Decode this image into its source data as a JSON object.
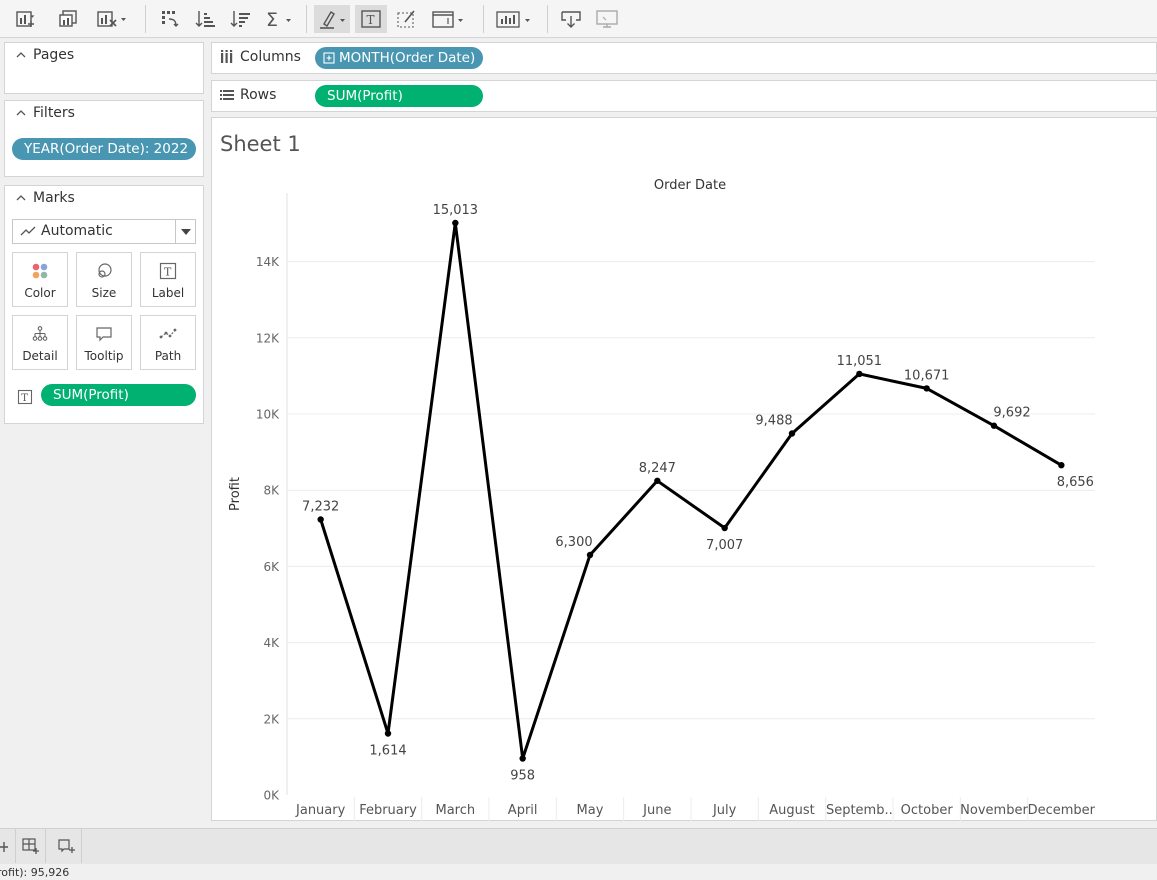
{
  "toolbar": {
    "icons": [
      "new-worksheet-icon",
      "duplicate-sheet-icon",
      "clear-sheet-icon",
      "swap-rows-columns-icon",
      "sort-ascending-icon",
      "sort-descending-icon",
      "totals-icon",
      "highlight-icon",
      "show-mark-labels-icon",
      "format-workbook-icon",
      "fit-icon",
      "show-me-icon",
      "download-icon",
      "presentation-mode-icon"
    ]
  },
  "pages": {
    "title": "Pages"
  },
  "filters": {
    "title": "Filters",
    "items": [
      "YEAR(Order Date): 2022"
    ]
  },
  "marks": {
    "title": "Marks",
    "type": "Automatic",
    "cards": [
      "Color",
      "Size",
      "Label",
      "Detail",
      "Tooltip",
      "Path"
    ],
    "fields": [
      "SUM(Profit)"
    ]
  },
  "columns": {
    "label": "Columns",
    "pill": "MONTH(Order Date)"
  },
  "rows": {
    "label": "Rows",
    "pill": "SUM(Profit)"
  },
  "sheet": {
    "title": "Sheet 1"
  },
  "colors": {
    "dimension_pill": "#4996b2",
    "measure_pill": "#00b171",
    "line": "#000000"
  },
  "chart_data": {
    "type": "line",
    "title": "Order Date",
    "xlabel": "",
    "ylabel": "Profit",
    "categories": [
      "January",
      "February",
      "March",
      "April",
      "May",
      "June",
      "July",
      "August",
      "Septemb..",
      "October",
      "November",
      "December"
    ],
    "values": [
      7232,
      1614,
      15013,
      958,
      6300,
      8247,
      7007,
      9488,
      11051,
      10671,
      9692,
      8656
    ],
    "data_labels": [
      "7,232",
      "1,614",
      "15,013",
      "958",
      "6,300",
      "8,247",
      "7,007",
      "9,488",
      "11,051",
      "10,671",
      "9,692",
      "8,656"
    ],
    "ylim": [
      0,
      15800
    ],
    "yticks": [
      0,
      2000,
      4000,
      6000,
      8000,
      10000,
      12000,
      14000
    ],
    "ytick_labels": [
      "0K",
      "2K",
      "4K",
      "6K",
      "8K",
      "10K",
      "12K",
      "14K"
    ],
    "grid": true,
    "legend": "none"
  },
  "status": {
    "text": "rofit): 95,926"
  }
}
